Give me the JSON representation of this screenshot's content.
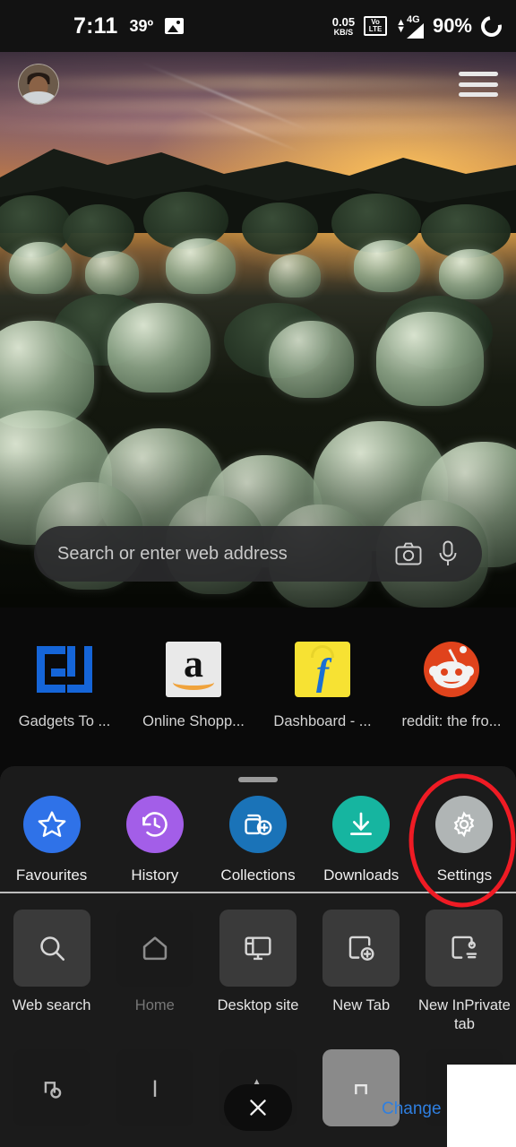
{
  "status_bar": {
    "time": "7:11",
    "temperature": "39º",
    "image_icon": "photo-icon",
    "data_speed_value": "0.05",
    "data_speed_unit": "KB/S",
    "volte_top": "Vo",
    "volte_bottom": "LTE",
    "network_type": "4G",
    "battery_percent": "90%",
    "battery_icon": "battery-circle-icon"
  },
  "top_bar": {
    "avatar_name": "profile-avatar",
    "menu_icon": "hamburger-menu-icon"
  },
  "search": {
    "placeholder": "Search or enter web address",
    "camera_icon": "camera-icon",
    "mic_icon": "microphone-icon"
  },
  "shortcuts": [
    {
      "label": "Gadgets To ...",
      "icon": "gadgets-to-use-logo"
    },
    {
      "label": "Online Shopp...",
      "icon": "amazon-logo"
    },
    {
      "label": "Dashboard - ...",
      "icon": "flipkart-logo"
    },
    {
      "label": "reddit: the fro...",
      "icon": "reddit-logo"
    }
  ],
  "sheet": {
    "grab_handle": "drag-handle",
    "quick_actions": [
      {
        "label": "Favourites",
        "icon": "star-icon",
        "color": "#2f72e8"
      },
      {
        "label": "History",
        "icon": "history-clock-icon",
        "color": "#a35ee8"
      },
      {
        "label": "Collections",
        "icon": "collections-add-icon",
        "color": "#1a73b8"
      },
      {
        "label": "Downloads",
        "icon": "download-icon",
        "color": "#16b5a0"
      },
      {
        "label": "Settings",
        "icon": "gear-icon",
        "color": "#b0b5b5"
      }
    ],
    "grid_row1": [
      {
        "label": "Web search",
        "icon": "search-icon",
        "tile": "normal",
        "dim": false
      },
      {
        "label": "Home",
        "icon": "home-icon",
        "tile": "dark",
        "dim": true
      },
      {
        "label": "Desktop site",
        "icon": "desktop-monitor-icon",
        "tile": "normal",
        "dim": false
      },
      {
        "label": "New Tab",
        "icon": "new-tab-icon",
        "tile": "normal",
        "dim": false
      },
      {
        "label": "New InPrivate tab",
        "icon": "inprivate-tab-icon",
        "tile": "normal",
        "dim": false
      }
    ],
    "grid_row2": [
      {
        "icon": "find-on-page-icon",
        "tile": "dark"
      },
      {
        "icon": "read-aloud-icon",
        "tile": "dark"
      },
      {
        "icon": "translate-icon",
        "tile": "dark"
      },
      {
        "icon": "share-icon",
        "tile": "light"
      },
      {
        "icon": "more-icon",
        "tile": "dark"
      }
    ],
    "close_icon": "close-x-icon",
    "change_link": "Change"
  },
  "annotation": {
    "shape": "red-ellipse-highlight",
    "target": "Settings",
    "color": "#ef1b24"
  },
  "overlay": {
    "white_box": "white-occlusion-rectangle"
  }
}
